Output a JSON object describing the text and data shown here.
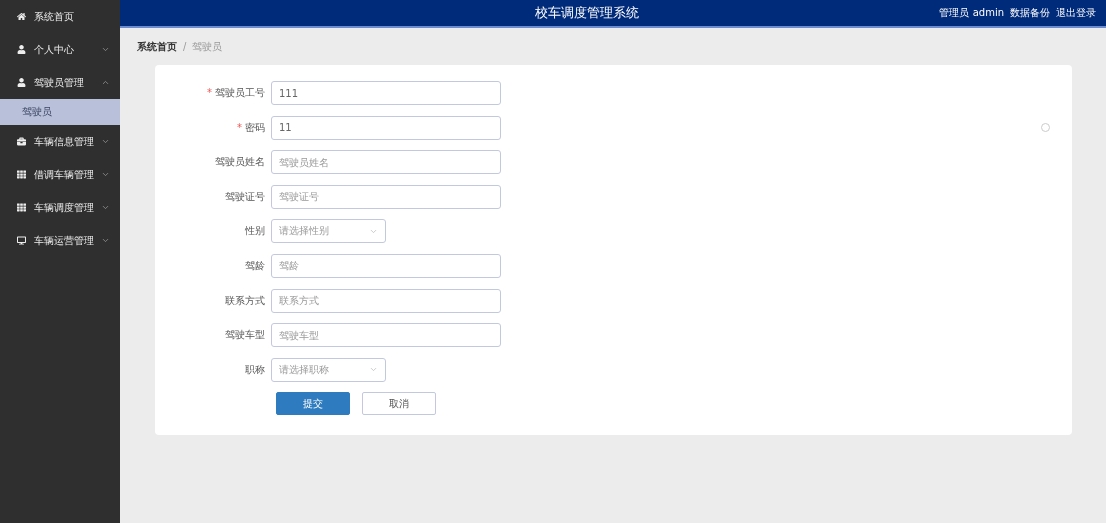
{
  "sidebar": {
    "items": [
      {
        "label": "系统首页",
        "has_toggle": false
      },
      {
        "label": "个人中心",
        "expanded": false,
        "has_toggle": true
      },
      {
        "label": "驾驶员管理",
        "expanded": true,
        "has_toggle": true,
        "children": [
          {
            "label": "驾驶员",
            "selected": true
          }
        ]
      },
      {
        "label": "车辆信息管理",
        "expanded": false,
        "has_toggle": true
      },
      {
        "label": "借调车辆管理",
        "expanded": false,
        "has_toggle": true
      },
      {
        "label": "车辆调度管理",
        "expanded": false,
        "has_toggle": true
      },
      {
        "label": "车辆运营管理",
        "expanded": false,
        "has_toggle": true
      }
    ]
  },
  "header": {
    "title": "校车调度管理系统",
    "user": "管理员 admin",
    "links": [
      "数据备份",
      "退出登录"
    ]
  },
  "breadcrumb": {
    "separator": "/",
    "items": [
      "系统首页",
      "驾驶员"
    ]
  },
  "form": {
    "required_mark": "*",
    "fields": [
      {
        "kind": "input",
        "label": "驾驶员工号",
        "required": true,
        "value": "111"
      },
      {
        "kind": "input",
        "label": "密码",
        "required": true,
        "value": "11"
      },
      {
        "kind": "input",
        "label": "驾驶员姓名",
        "required": false,
        "placeholder": "驾驶员姓名"
      },
      {
        "kind": "input",
        "label": "驾驶证号",
        "required": false,
        "placeholder": "驾驶证号"
      },
      {
        "kind": "select",
        "label": "性别",
        "required": false,
        "placeholder": "请选择性别"
      },
      {
        "kind": "input",
        "label": "驾龄",
        "required": false,
        "placeholder": "驾龄"
      },
      {
        "kind": "input",
        "label": "联系方式",
        "required": false,
        "placeholder": "联系方式"
      },
      {
        "kind": "input",
        "label": "驾驶车型",
        "required": false,
        "placeholder": "驾驶车型"
      },
      {
        "kind": "select",
        "label": "职称",
        "required": false,
        "placeholder": "请选择职称"
      }
    ],
    "buttons": [
      {
        "kind": "primary",
        "label": "提交"
      },
      {
        "kind": "default",
        "label": "取消"
      }
    ]
  }
}
